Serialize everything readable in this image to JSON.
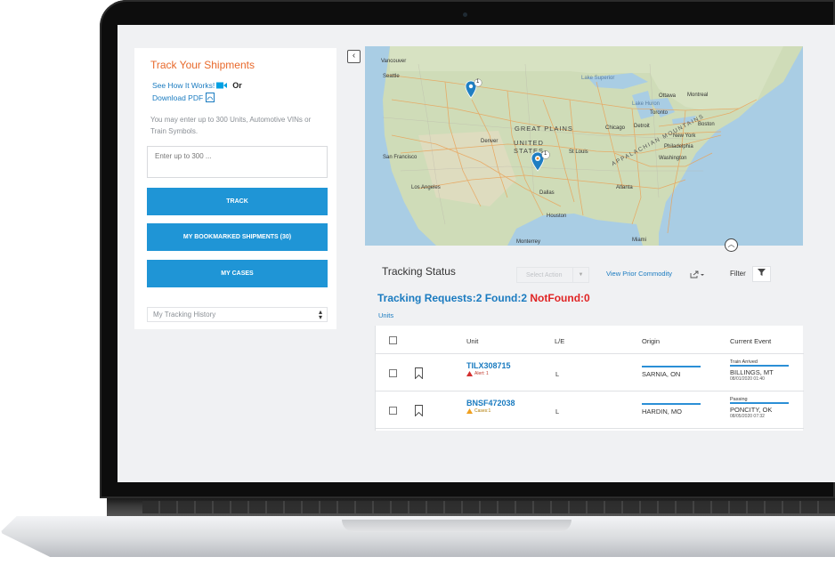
{
  "left_panel": {
    "title": "Track Your Shipments",
    "see_how": "See How It Works!",
    "or": "Or",
    "download_pdf": "Download PDF",
    "hint": "You may enter up to 300 Units, Automotive VINs or Train Symbols.",
    "input_placeholder": "Enter up to 300 ...",
    "track_button": "TRACK",
    "bookmarked_button": "MY BOOKMARKED SHIPMENTS (30)",
    "cases_button": "MY CASES",
    "history_select": "My Tracking History"
  },
  "map": {
    "labels": {
      "vancouver": "Vancouver",
      "seattle": "Seattle",
      "lake_superior": "Lake Superior",
      "lake_huron": "Lake Huron",
      "ottawa": "Ottawa",
      "montreal": "Montreal",
      "toronto": "Toronto",
      "boston": "Boston",
      "detroit": "Detroit",
      "chicago": "Chicago",
      "new_york": "New York",
      "philadelphia": "Philadelphia",
      "washington": "Washington",
      "great_plains": "GREAT PLAINS",
      "united_states": "UNITED STATES",
      "denver": "Denver",
      "san_francisco": "San Francisco",
      "st_louis": "St Louis",
      "los_angeles": "Los Angeles",
      "atlanta": "Atlanta",
      "dallas": "Dallas",
      "houston": "Houston",
      "monterrey": "Monterrey",
      "miami": "Miami",
      "appalachian": "APPALACHIAN MOUNTAINS"
    },
    "pins": [
      {
        "count": "1"
      },
      {
        "count": "1"
      }
    ]
  },
  "tracking": {
    "title": "Tracking Status",
    "select_action": "Select Action",
    "view_prior": "View Prior Commodity",
    "filter_label": "Filter",
    "summary_requests": "Tracking Requests:2",
    "summary_found": "Found:2",
    "summary_notfound": "NotFound:0",
    "units_tab": "Units",
    "columns": [
      "Unit",
      "L/E",
      "Origin",
      "Current Event"
    ],
    "rows": [
      {
        "unit": "TILX308715",
        "badge": "Alert: 1",
        "le": "L",
        "origin": "SARNIA, ON",
        "event_status": "Train Arrived",
        "event_location": "BILLINGS, MT",
        "event_time": "08/01/2020 01:40"
      },
      {
        "unit": "BNSF472038",
        "badge": "Cases:1",
        "le": "L",
        "origin": "HARDIN, MO",
        "event_status": "Passing",
        "event_location": "PONCITY, OK",
        "event_time": "08/05/2020 07:32"
      }
    ]
  }
}
